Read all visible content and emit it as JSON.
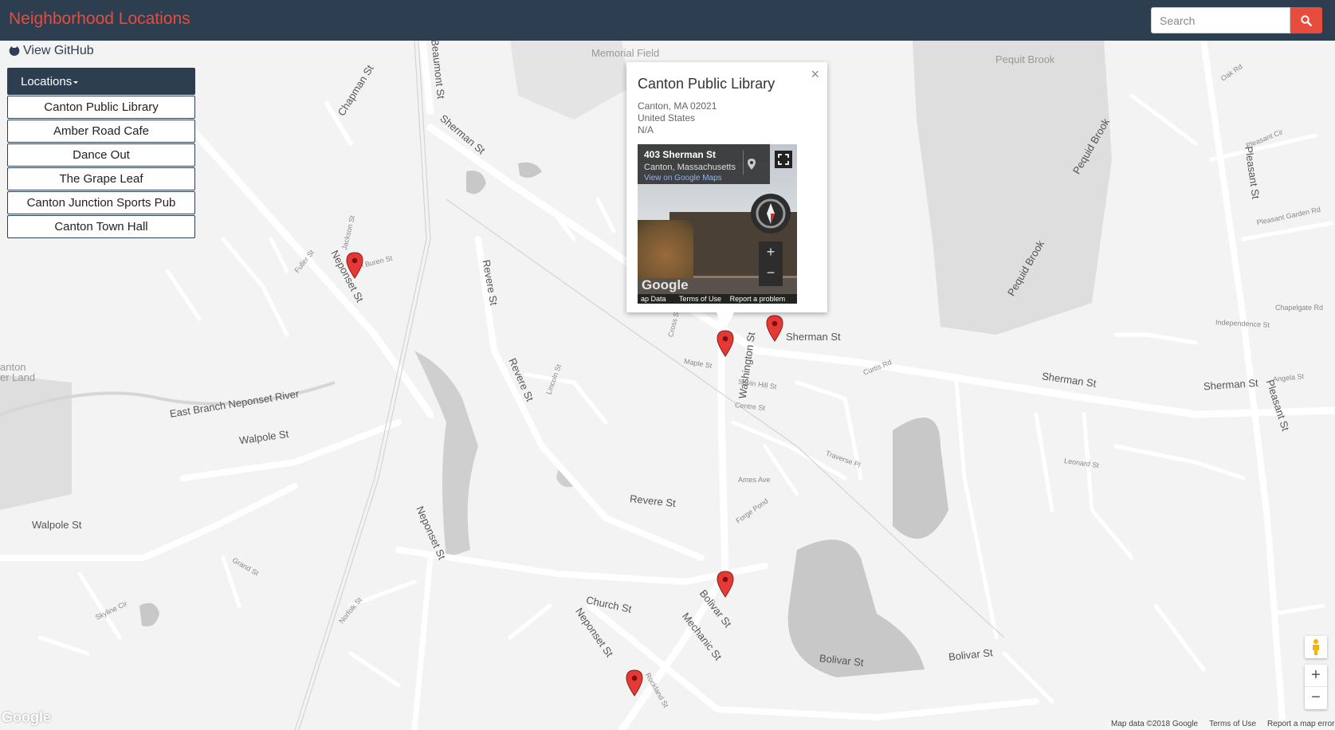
{
  "navbar": {
    "title": "Neighborhood Locations",
    "search_placeholder": "Search",
    "search_icon": "search-icon",
    "accent": "#e74c3c",
    "background": "#2c3e50"
  },
  "sidebar": {
    "github_label": "View GitHub",
    "github_icon": "github-icon",
    "header": "Locations",
    "items": [
      {
        "label": "Canton Public Library"
      },
      {
        "label": "Amber Road Cafe"
      },
      {
        "label": "Dance Out"
      },
      {
        "label": "The Grape Leaf"
      },
      {
        "label": "Canton Junction Sports Pub"
      },
      {
        "label": "Canton Town Hall"
      }
    ]
  },
  "infowindow": {
    "title": "Canton Public Library",
    "address_line1": "Canton, MA 02021",
    "address_line2": "United States",
    "phone": "N/A",
    "close": "×",
    "streetview": {
      "street": "403 Sherman St",
      "city": "Canton, Massachusetts",
      "link": "View on Google Maps",
      "footer_data": "ap Data",
      "footer_terms": "Terms of Use",
      "footer_report": "Report a problem",
      "logo": "Google"
    }
  },
  "map": {
    "labels": {
      "memorial_field": "Memorial Field",
      "pequit_brook": "Pequit Brook",
      "canton_land": "anton\ner Land",
      "east_branch": "East Branch Neponset River",
      "walpole_st": "Walpole St",
      "sherman_st": "Sherman St",
      "neponset_st": "Neponset St",
      "revere_st": "Revere St",
      "washington_st": "Washington St",
      "bolivar_st": "Bolivar St",
      "pleasant_st": "Pleasant St",
      "church_st": "Church St",
      "mechanic_st": "Mechanic St",
      "pequid_brook": "Pequid Brook",
      "chapman_st": "Chapman St",
      "beaumont_st": "Beaumont St",
      "leonard_st": "Leonard St",
      "curtis_rd": "Curtis Rd",
      "cross_st": "Cross St",
      "maple_st": "Maple St",
      "savin_hill": "Savin Hill St",
      "centre_st": "Centre St",
      "ames_ave": "Ames Ave",
      "forge_pond": "Forge Pond",
      "van_buren": "Van Buren St",
      "jackson_st": "Jackson St",
      "fuller_st": "Fuller St",
      "lincoln_st": "Lincoln St",
      "traverse_pl": "Traverse Pl",
      "angela_st": "Angela St",
      "independence": "Independence St",
      "chapelgate": "Chapelgate Rd",
      "pleasant_garden": "Pleasant Garden Rd",
      "pleasant_cir": "Pleasant Cir",
      "oak_rd": "Oak Rd",
      "skyline": "Skyline Cir",
      "grand_st": "Grand St",
      "rockland": "Rockland St",
      "norfolk": "Norfolk St"
    },
    "google_logo": "Google",
    "attribution": [
      "Map data ©2018 Google",
      "Terms of Use",
      "Report a map error"
    ],
    "zoom_in": "+",
    "zoom_out": "−",
    "pegman_icon": "pegman-icon"
  }
}
